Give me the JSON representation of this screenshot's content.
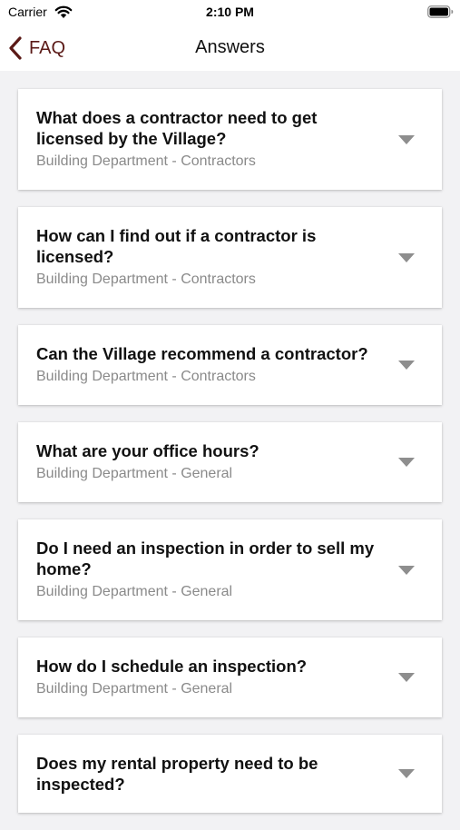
{
  "status_bar": {
    "carrier": "Carrier",
    "time": "2:10 PM",
    "wifi_icon": "wifi-icon",
    "battery_icon": "battery-icon"
  },
  "nav": {
    "back_label": "FAQ",
    "back_icon": "chevron-left-icon",
    "title": "Answers",
    "accent_color": "#5b1a17"
  },
  "faqs": [
    {
      "question": "What does a contractor need to get licensed by the Village?",
      "category": "Building Department - Contractors"
    },
    {
      "question": "How can I find out if a contractor is licensed?",
      "category": "Building Department - Contractors"
    },
    {
      "question": "Can the Village recommend a contractor?",
      "category": "Building Department - Contractors"
    },
    {
      "question": "What are your office hours?",
      "category": "Building Department - General"
    },
    {
      "question": "Do I need an inspection in order to sell my home?",
      "category": "Building Department - General"
    },
    {
      "question": "How do I schedule an inspection?",
      "category": "Building Department - General"
    },
    {
      "question": "Does my rental property need to be inspected?",
      "category": ""
    }
  ]
}
